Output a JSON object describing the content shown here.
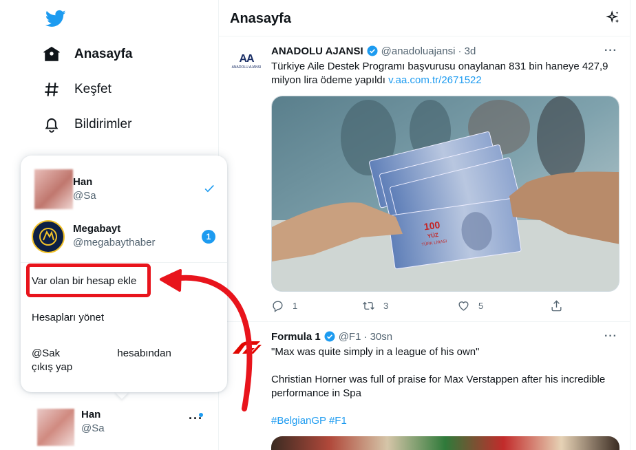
{
  "sidebar": {
    "nav": [
      {
        "label": "Anasayfa",
        "icon": "home-icon"
      },
      {
        "label": "Keşfet",
        "icon": "hashtag-icon"
      },
      {
        "label": "Bildirimler",
        "icon": "bell-icon"
      }
    ],
    "current_account": {
      "name": "Han",
      "handle": "@Sa"
    }
  },
  "account_menu": {
    "accounts": [
      {
        "name": "Han",
        "handle": "@Sa",
        "selected": true
      },
      {
        "name": "Megabayt",
        "handle": "@megabaythaber",
        "notification_count": "1"
      }
    ],
    "add_existing": "Var olan bir hesap ekle",
    "manage": "Hesapları yönet",
    "logout_line1": "@Sak                    hesabından",
    "logout_line2": "çıkış yap"
  },
  "main": {
    "title": "Anasayfa",
    "tweets": [
      {
        "name": "ANADOLU AJANSI",
        "handle": "@anadoluajansi",
        "time": "· 3d",
        "avatar_text": "AA",
        "avatar_sub": "ANADOLU AJANSI",
        "text": "Türkiye Aile Destek Programı başvurusu onaylanan 831 bin haneye 427,9 milyon lira ödeme yapıldı ",
        "link": "v.aa.com.tr/2671522",
        "image_note_100": "100",
        "image_note_yuz": "YÜZ",
        "image_note_lira": "TÜRK LİRASI",
        "replies": "1",
        "retweets": "3",
        "likes": "5"
      },
      {
        "name": "Formula 1",
        "handle": "@F1",
        "time": "· 30sn",
        "line1": "\"Max was quite simply in a league of his own\"",
        "line2": "Christian Horner was full of praise for Max Verstappen after his incredible performance in Spa",
        "hashtags": "#BelgianGP #F1"
      }
    ]
  },
  "colors": {
    "accent": "#1d9bf0",
    "annotation": "#e8141c"
  }
}
